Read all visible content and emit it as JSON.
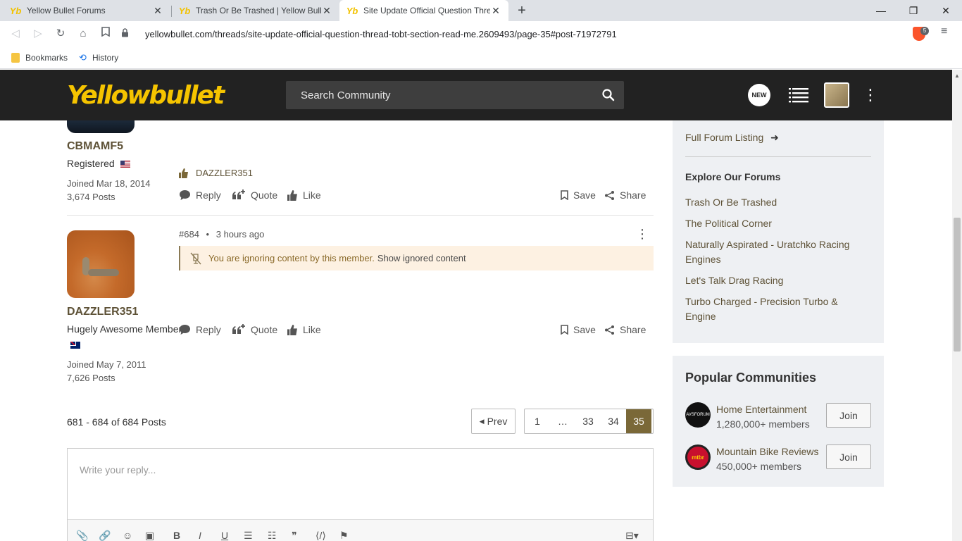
{
  "browser": {
    "tabs": [
      {
        "title": "Yellow Bullet Forums"
      },
      {
        "title": "Trash Or Be Trashed | Yellow Bullet"
      },
      {
        "title": "Site Update Official Question Thread"
      }
    ],
    "url": "yellowbullet.com/threads/site-update-official-question-thread-tobt-section-read-me.2609493/page-35#post-71972791",
    "brave_badge": "5",
    "bookmarks": [
      {
        "label": "Bookmarks"
      },
      {
        "label": "History"
      }
    ]
  },
  "header": {
    "logo": "Yellowbullet",
    "search_placeholder": "Search Community",
    "new_badge": "NEW"
  },
  "post1": {
    "username": "CBMAMF5",
    "title": "Registered",
    "joined": "Joined Mar 18, 2014",
    "posts": "3,674 Posts",
    "liked_by": "DAZZLER351",
    "actions": {
      "reply": "Reply",
      "quote": "Quote",
      "like": "Like",
      "save": "Save",
      "share": "Share"
    }
  },
  "post2": {
    "number": "#684",
    "sep": "•",
    "time": "3 hours ago",
    "username": "DAZZLER351",
    "title": "Hugely Awesome Member",
    "joined": "Joined May 7, 2011",
    "posts": "7,626 Posts",
    "ignored_text": "You are ignoring content by this member.",
    "ignored_link": "Show ignored content",
    "actions": {
      "reply": "Reply",
      "quote": "Quote",
      "like": "Like",
      "save": "Save",
      "share": "Share"
    }
  },
  "pagination": {
    "summary": "681 - 684 of 684 Posts",
    "prev": "Prev",
    "pages": [
      "1",
      "…",
      "33",
      "34",
      "35"
    ],
    "current": "35"
  },
  "reply": {
    "placeholder": "Write your reply..."
  },
  "sidebar": {
    "full_listing": "Full Forum Listing",
    "explore_title": "Explore Our Forums",
    "forums": [
      "Trash Or Be Trashed",
      "The Political Corner",
      "Naturally Aspirated - Uratchko Racing Engines",
      "Let's Talk Drag Racing",
      "Turbo Charged - Precision Turbo & Engine"
    ],
    "popular_title": "Popular Communities",
    "communities": [
      {
        "name": "Home Entertainment",
        "members": "1,280,000+ members",
        "join": "Join",
        "logo_text": "AVSFORUM"
      },
      {
        "name": "Mountain Bike Reviews",
        "members": "450,000+ members",
        "join": "Join",
        "logo_text": "mtbr"
      }
    ]
  },
  "colors": {
    "header_bg": "#222222",
    "logo": "#f5c400",
    "accent": "#7a6838",
    "link": "#5e5237",
    "ignored_bg": "#fdf1e2"
  }
}
